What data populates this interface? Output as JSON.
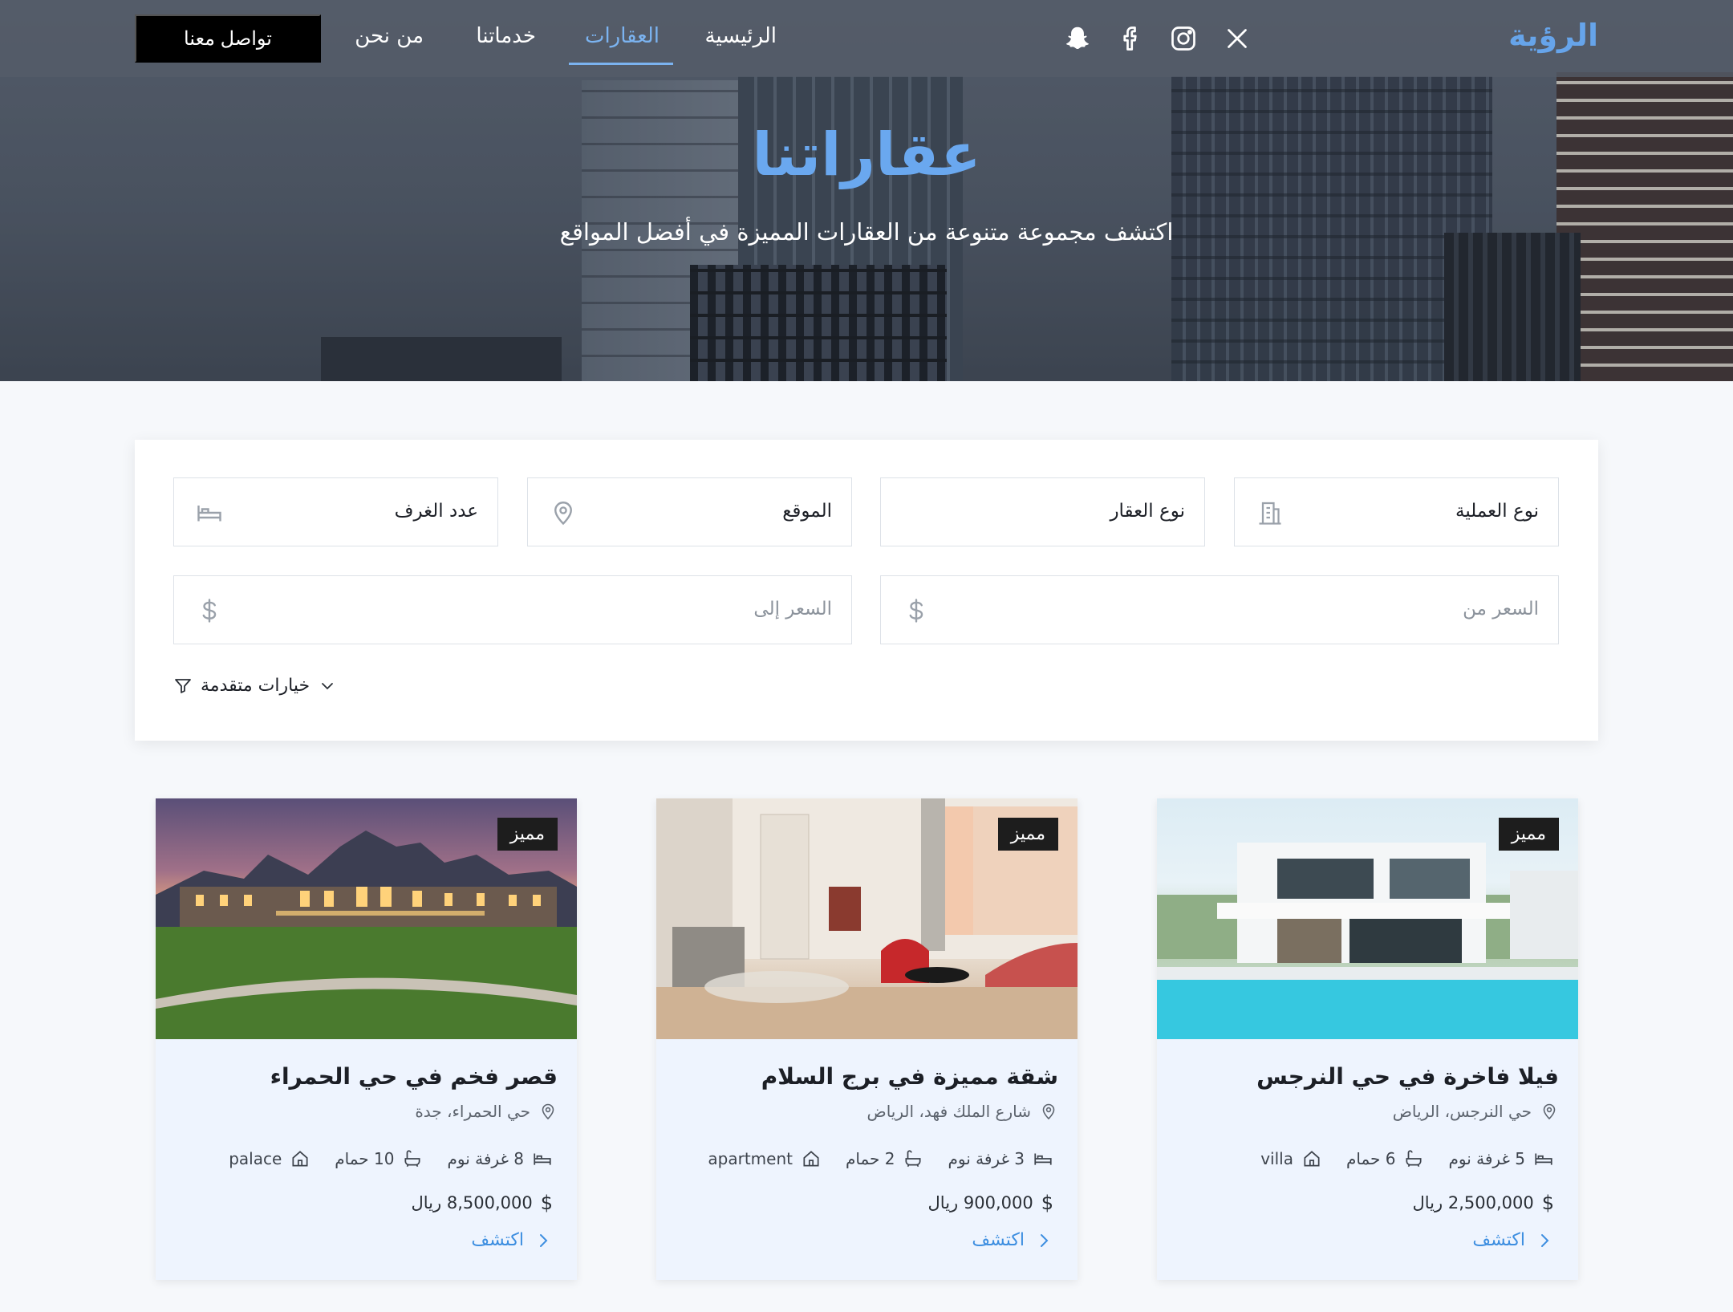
{
  "nav": {
    "brand": "الرؤية",
    "menu": {
      "home": "الرئيسية",
      "properties": "العقارات",
      "services": "خدماتنا",
      "about": "من نحن"
    },
    "cta": "تواصل معنا",
    "social_icons": [
      "x-icon",
      "instagram-icon",
      "facebook-icon",
      "snapchat-icon"
    ],
    "active_color": "#7bb3f0"
  },
  "hero": {
    "title": "عقاراتنا",
    "subtitle": "اكتشف مجموعة متنوعة من العقارات المميزة في أفضل المواقع",
    "title_color": "#6aa8ef"
  },
  "search": {
    "operation_type": "نوع العملية",
    "property_type": "نوع العقار",
    "location": "الموقع",
    "rooms": "عدد الغرف",
    "price_from_placeholder": "السعر من",
    "price_to_placeholder": "السعر إلى",
    "advanced": "خيارات متقدمة"
  },
  "cards": [
    {
      "badge": "مميز",
      "title": "فيلا فاخرة في حي النرجس",
      "address": "حي النرجس، الرياض",
      "bedrooms": "5 غرفة نوم",
      "bathrooms": "6 حمام",
      "type": "villa",
      "price": "2,500,000 ريال",
      "explore": "اكتشف"
    },
    {
      "badge": "مميز",
      "title": "شقة مميزة في برج السلام",
      "address": "شارع الملك فهد، الرياض",
      "bedrooms": "3 غرفة نوم",
      "bathrooms": "2 حمام",
      "type": "apartment",
      "price": "900,000 ريال",
      "explore": "اكتشف"
    },
    {
      "badge": "مميز",
      "title": "قصر فخم في حي الحمراء",
      "address": "حي الحمراء، جدة",
      "bedrooms": "8 غرفة نوم",
      "bathrooms": "10 حمام",
      "type": "palace",
      "price": "8,500,000 ريال",
      "explore": "اكتشف"
    }
  ]
}
